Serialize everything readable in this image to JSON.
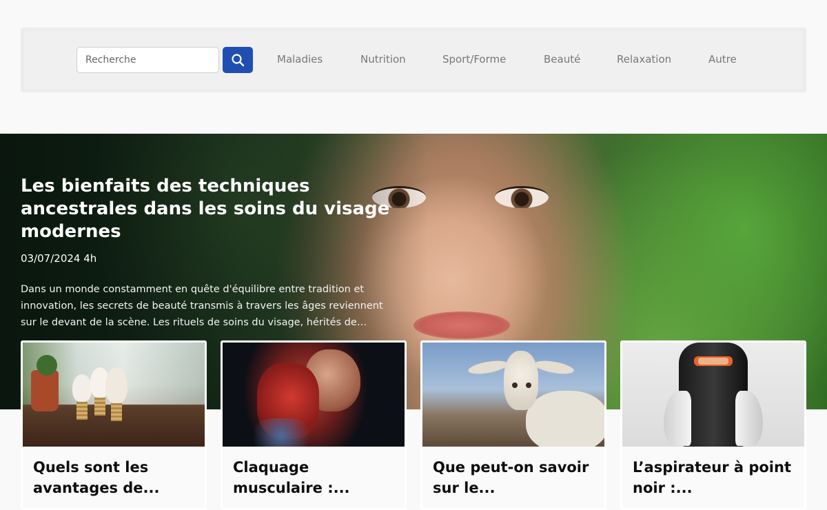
{
  "search": {
    "placeholder": "Recherche"
  },
  "nav": {
    "items": [
      "Maladies",
      "Nutrition",
      "Sport/Forme",
      "Beauté",
      "Relaxation",
      "Autre"
    ]
  },
  "hero": {
    "title": "Les bienfaits des techniques ancestrales dans les soins du visage modernes",
    "date": "03/07/2024 4h",
    "excerpt": "Dans un monde constamment en quête d'équilibre entre tradition et innovation, les secrets de beauté transmis à travers les âges reviennent sur le devant de la scène. Les rituels de soins du visage, hérités de nos..."
  },
  "cards": [
    {
      "title": "Quels sont les avantages de..."
    },
    {
      "title": "Claquage musculaire :..."
    },
    {
      "title": "Que peut-on savoir sur le..."
    },
    {
      "title": "L’aspirateur à point noir :..."
    }
  ],
  "colors": {
    "accent": "#1f4fb3",
    "nav_text": "#777777"
  }
}
